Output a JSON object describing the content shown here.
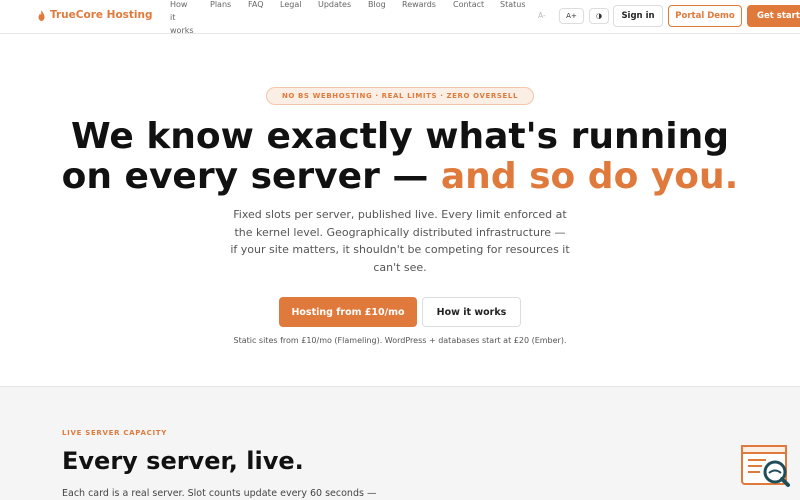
{
  "brand": {
    "name": "TrueCore Hosting",
    "accent_color": "#e07a3c",
    "logo_icon": "flame-icon"
  },
  "nav": {
    "links": [
      {
        "label": "How\nit\nworks"
      },
      {
        "label": "Plans"
      },
      {
        "label": "FAQ"
      },
      {
        "label": "Legal"
      },
      {
        "label": "Updates"
      },
      {
        "label": "Blog"
      },
      {
        "label": "Rewards"
      },
      {
        "label": "Contact"
      },
      {
        "label": "Status"
      }
    ],
    "font_decrease": "A-",
    "font_increase": "A+",
    "theme_toggle": "◑",
    "sign_in": "Sign in",
    "portal_demo": "Portal Demo",
    "get_started": "Get started"
  },
  "hero": {
    "badge": "NO BS WEBHOSTING · REAL LIMITS · ZERO OVERSELL",
    "title_line1": "We know exactly what's running",
    "title_line2_plain": "on every server — ",
    "title_line2_accent": "and so do you.",
    "subtitle": "Fixed slots per server, published live. Every limit enforced at the kernel level. Geographically distributed infrastructure — if your site matters, it shouldn't be competing for resources it can't see.",
    "cta_primary": "Hosting from £10/mo",
    "cta_secondary": "How it works",
    "pricing_note": "Static sites from £10/mo (Flameling). WordPress + databases start at £20 (Ember)."
  },
  "capacity": {
    "eyebrow": "LIVE SERVER CAPACITY",
    "title": "Every server, live.",
    "description": "Each card is a real server. Slot counts update every 60 seconds —"
  },
  "widget": {
    "icon": "search-window-icon"
  }
}
